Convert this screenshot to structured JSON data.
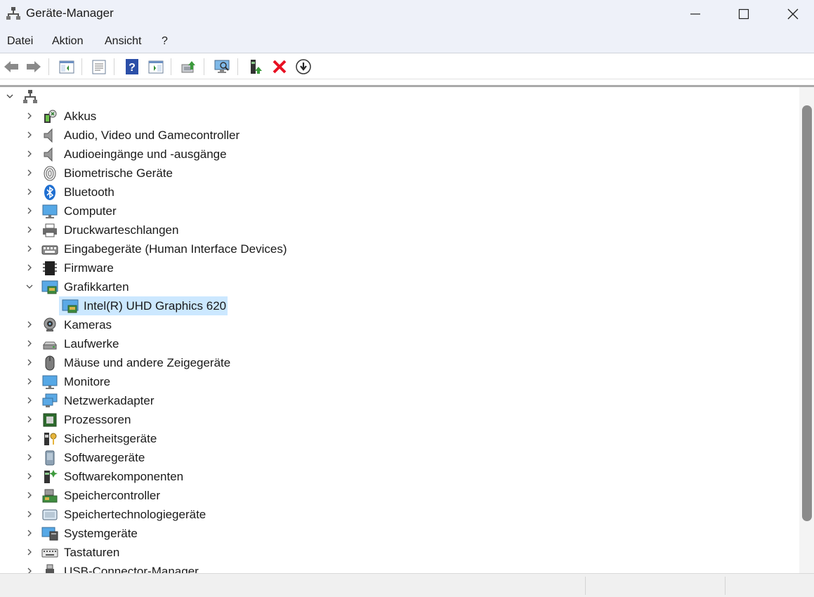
{
  "window": {
    "title": "Geräte-Manager"
  },
  "menu": [
    "Datei",
    "Aktion",
    "Ansicht",
    "?"
  ],
  "toolbar": {
    "icons": [
      "back-arrow-icon",
      "forward-arrow-icon",
      "console-tree-icon",
      "properties-sheet-icon",
      "help-icon",
      "action-pane-icon",
      "update-driver-icon",
      "scan-hardware-icon",
      "enable-device-icon",
      "uninstall-device-icon",
      "download-driver-icon"
    ]
  },
  "colors": {
    "selection": "#cce8ff",
    "titlebar": "#eef1f9",
    "uninstall_red": "#e81123"
  },
  "tree": {
    "root_label": "",
    "items": [
      {
        "label": "Akkus",
        "icon": "battery-icon",
        "expanded": false
      },
      {
        "label": "Audio, Video und Gamecontroller",
        "icon": "speaker-icon",
        "expanded": false
      },
      {
        "label": "Audioeingänge und -ausgänge",
        "icon": "speaker-icon",
        "expanded": false
      },
      {
        "label": "Biometrische Geräte",
        "icon": "fingerprint-icon",
        "expanded": false
      },
      {
        "label": "Bluetooth",
        "icon": "bluetooth-icon",
        "expanded": false
      },
      {
        "label": "Computer",
        "icon": "monitor-icon",
        "expanded": false
      },
      {
        "label": "Druckwarteschlangen",
        "icon": "printer-icon",
        "expanded": false
      },
      {
        "label": "Eingabegeräte (Human Interface Devices)",
        "icon": "hid-icon",
        "expanded": false
      },
      {
        "label": "Firmware",
        "icon": "chip-icon",
        "expanded": false
      },
      {
        "label": "Grafikkarten",
        "icon": "display-adapter-icon",
        "expanded": true,
        "children": [
          {
            "label": "Intel(R) UHD Graphics 620",
            "icon": "display-adapter-icon",
            "selected": true
          }
        ]
      },
      {
        "label": "Kameras",
        "icon": "webcam-icon",
        "expanded": false
      },
      {
        "label": "Laufwerke",
        "icon": "drive-icon",
        "expanded": false
      },
      {
        "label": "Mäuse und andere Zeigegeräte",
        "icon": "mouse-icon",
        "expanded": false
      },
      {
        "label": "Monitore",
        "icon": "monitor-icon",
        "expanded": false
      },
      {
        "label": "Netzwerkadapter",
        "icon": "network-icon",
        "expanded": false
      },
      {
        "label": "Prozessoren",
        "icon": "processor-icon",
        "expanded": false
      },
      {
        "label": "Sicherheitsgeräte",
        "icon": "security-key-icon",
        "expanded": false
      },
      {
        "label": "Softwaregeräte",
        "icon": "software-device-icon",
        "expanded": false
      },
      {
        "label": "Softwarekomponenten",
        "icon": "software-component-icon",
        "expanded": false
      },
      {
        "label": "Speichercontroller",
        "icon": "storage-controller-icon",
        "expanded": false
      },
      {
        "label": "Speichertechnologiegeräte",
        "icon": "storage-tech-icon",
        "expanded": false
      },
      {
        "label": "Systemgeräte",
        "icon": "system-device-icon",
        "expanded": false
      },
      {
        "label": "Tastaturen",
        "icon": "keyboard-icon",
        "expanded": false
      },
      {
        "label": "USB-Connector-Manager",
        "icon": "usb-icon",
        "expanded": false
      }
    ]
  }
}
